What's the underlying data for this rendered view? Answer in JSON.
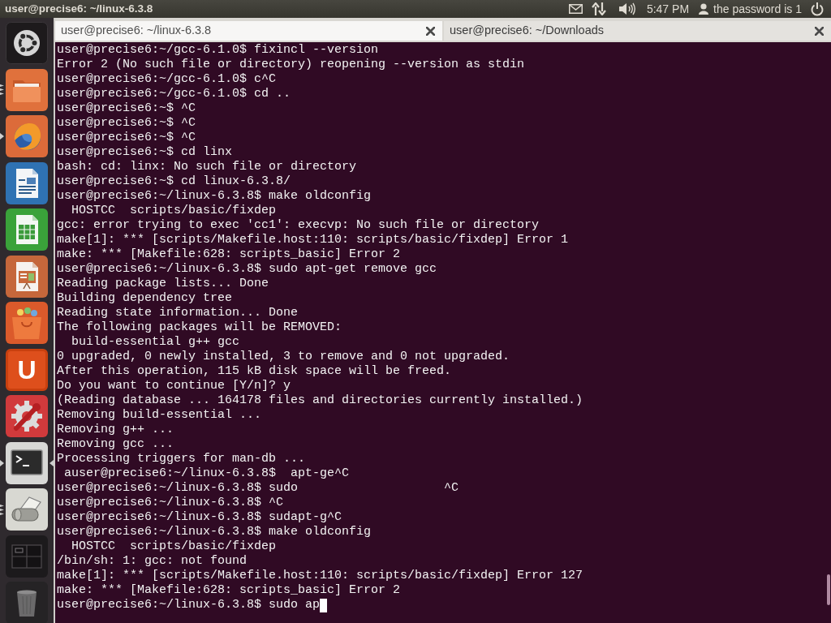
{
  "top_panel": {
    "title": "user@precise6: ~/linux-6.3.8",
    "clock": "5:47 PM",
    "user": "the password is 1"
  },
  "launcher": [
    {
      "kind": "dash",
      "running": false,
      "multiple_windows": false,
      "focused": false
    },
    {
      "kind": "files",
      "running": true,
      "multiple_windows": true,
      "focused": false
    },
    {
      "kind": "browser",
      "running": true,
      "multiple_windows": false,
      "focused": false
    },
    {
      "kind": "writer",
      "running": false,
      "multiple_windows": false,
      "focused": false
    },
    {
      "kind": "calc",
      "running": false,
      "multiple_windows": false,
      "focused": false
    },
    {
      "kind": "impress",
      "running": false,
      "multiple_windows": false,
      "focused": false
    },
    {
      "kind": "software",
      "running": false,
      "multiple_windows": false,
      "focused": false
    },
    {
      "kind": "ubuntu-one",
      "label": "U",
      "running": false,
      "multiple_windows": false,
      "focused": false
    },
    {
      "kind": "settings",
      "running": false,
      "multiple_windows": false,
      "focused": false
    },
    {
      "kind": "terminal",
      "running": true,
      "multiple_windows": false,
      "focused": true
    },
    {
      "kind": "scanner",
      "running": true,
      "multiple_windows": true,
      "focused": false
    },
    {
      "kind": "workspaces",
      "running": false,
      "multiple_windows": false,
      "focused": false
    },
    {
      "kind": "trash",
      "running": false,
      "multiple_windows": false,
      "focused": false
    }
  ],
  "tabs": [
    {
      "title": "user@precise6: ~/linux-6.3.8",
      "selected": true
    },
    {
      "title": "user@precise6: ~/Downloads",
      "selected": false
    }
  ],
  "terminal": {
    "lines": [
      "user@precise6:~/gcc-6.1.0$ fixincl --version",
      "Error 2 (No such file or directory) reopening --version as stdin",
      "user@precise6:~/gcc-6.1.0$ c^C",
      "user@precise6:~/gcc-6.1.0$ cd ..",
      "user@precise6:~$ ^C",
      "user@precise6:~$ ^C",
      "user@precise6:~$ ^C",
      "user@precise6:~$ cd linx",
      "bash: cd: linx: No such file or directory",
      "user@precise6:~$ cd linux-6.3.8/",
      "user@precise6:~/linux-6.3.8$ make oldconfig",
      "  HOSTCC  scripts/basic/fixdep",
      "gcc: error trying to exec 'cc1': execvp: No such file or directory",
      "make[1]: *** [scripts/Makefile.host:110: scripts/basic/fixdep] Error 1",
      "make: *** [Makefile:628: scripts_basic] Error 2",
      "user@precise6:~/linux-6.3.8$ sudo apt-get remove gcc",
      "Reading package lists... Done",
      "Building dependency tree",
      "Reading state information... Done",
      "The following packages will be REMOVED:",
      "  build-essential g++ gcc",
      "0 upgraded, 0 newly installed, 3 to remove and 0 not upgraded.",
      "After this operation, 115 kB disk space will be freed.",
      "Do you want to continue [Y/n]? y",
      "(Reading database ... 164178 files and directories currently installed.)",
      "Removing build-essential ...",
      "Removing g++ ...",
      "Removing gcc ...",
      "Processing triggers for man-db ...",
      " auser@precise6:~/linux-6.3.8$  apt-ge^C",
      "user@precise6:~/linux-6.3.8$ sudo                    ^C",
      "user@precise6:~/linux-6.3.8$ ^C",
      "user@precise6:~/linux-6.3.8$ sudapt-g^C",
      "user@precise6:~/linux-6.3.8$ make oldconfig",
      "  HOSTCC  scripts/basic/fixdep",
      "/bin/sh: 1: gcc: not found",
      "make[1]: *** [scripts/Makefile.host:110: scripts/basic/fixdep] Error 127",
      "make: *** [Makefile:628: scripts_basic] Error 2"
    ],
    "input_line": {
      "text": "user@precise6:~/linux-6.3.8$ sudo ap",
      "cursor": true
    }
  }
}
